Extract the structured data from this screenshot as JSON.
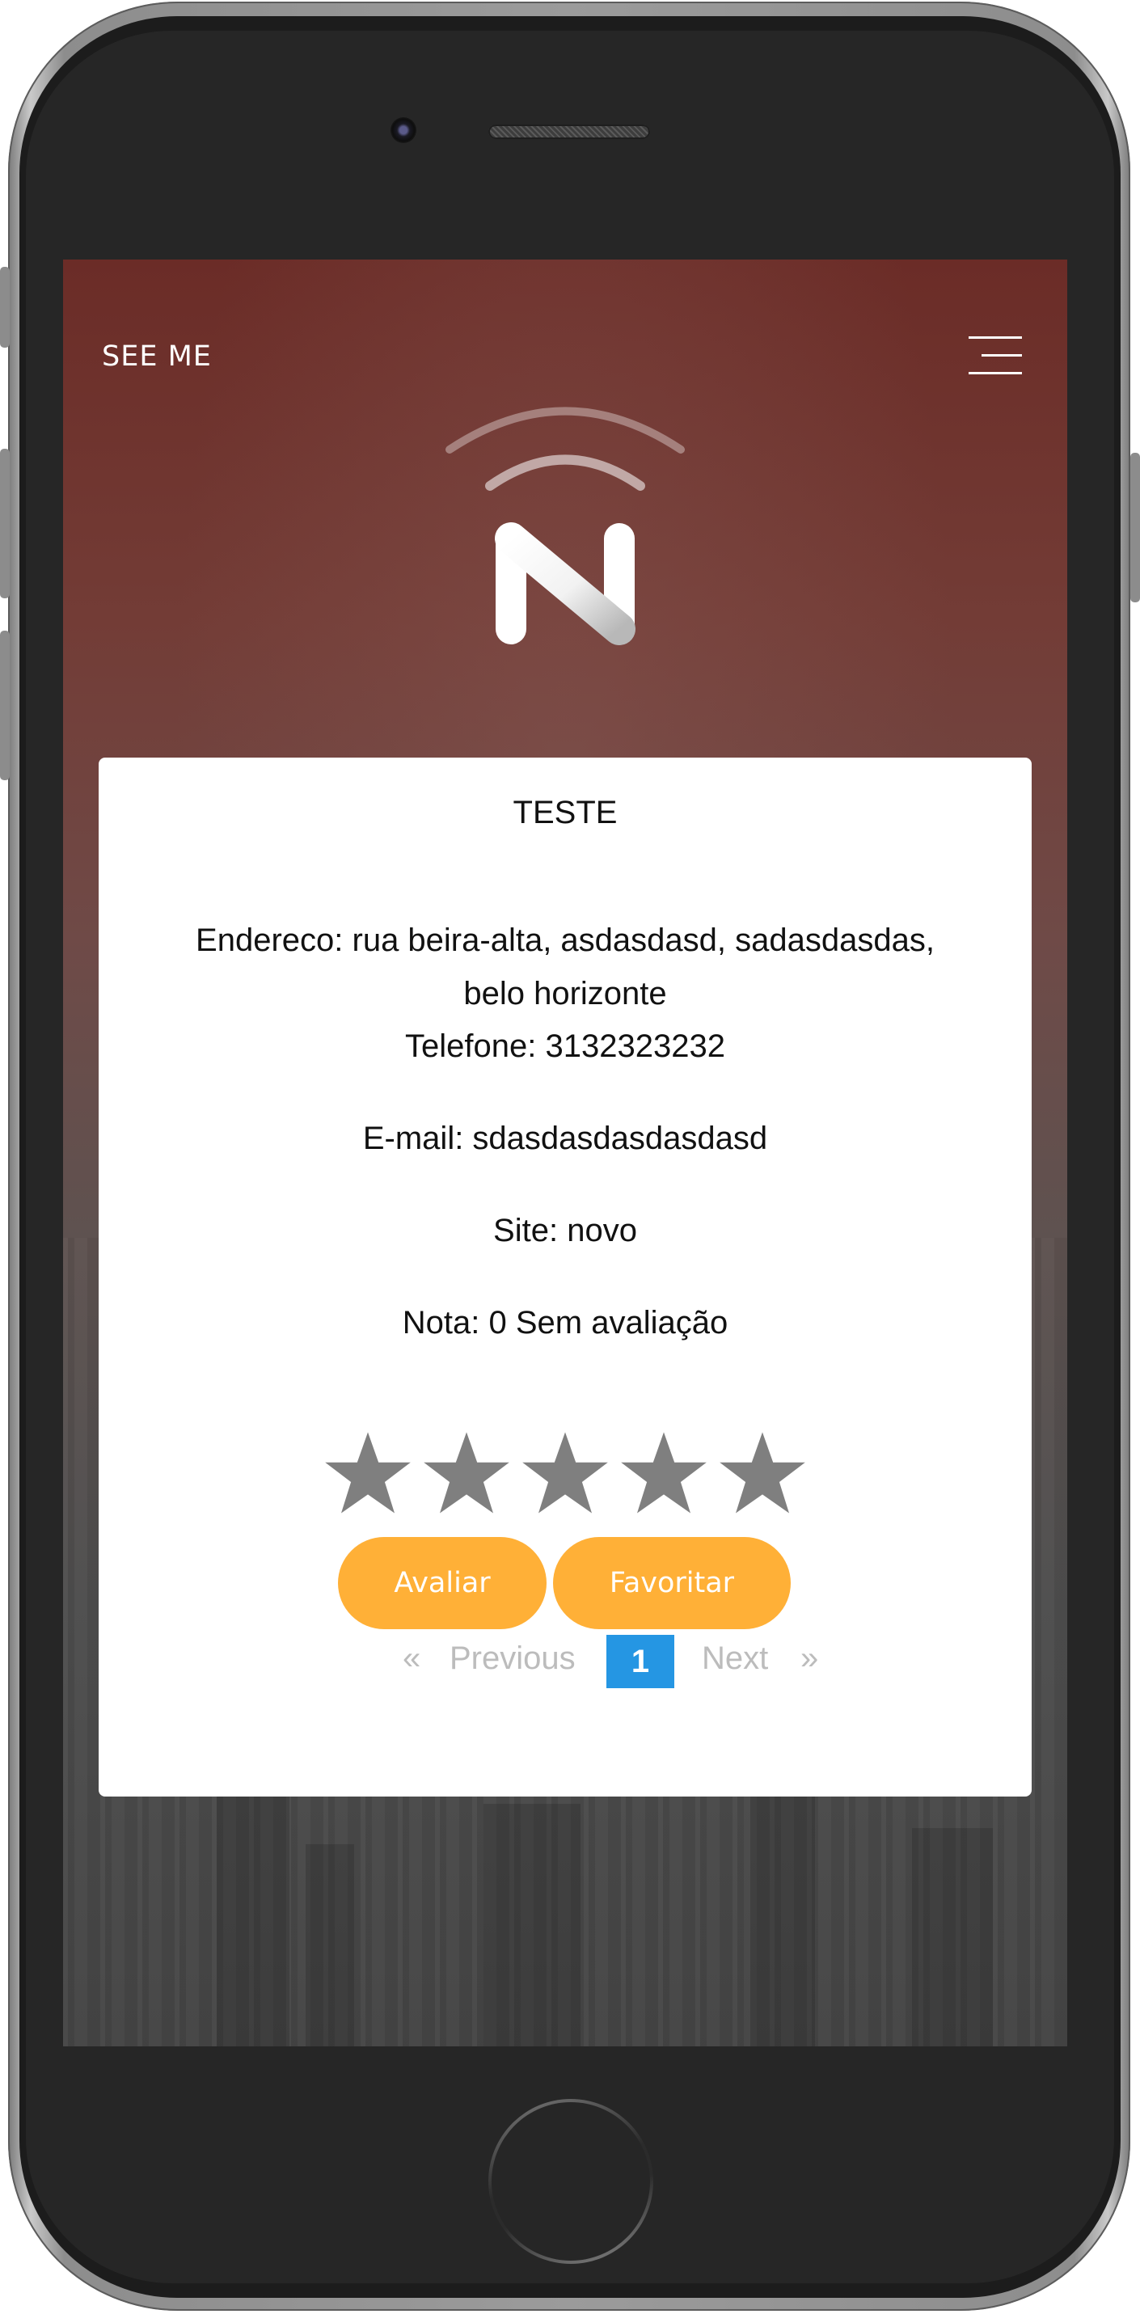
{
  "navbar": {
    "brand": "SEE ME",
    "menu_icon": "hamburger-icon"
  },
  "logo": {
    "icon": "n-signal-logo"
  },
  "card": {
    "title": "TESTE",
    "address": "Endereco: rua beira-alta, asdasdasd, sadasdasdas, belo horizonte",
    "phone": "Telefone: 3132323232",
    "email": "E-mail: sdasdasdasdasdasd",
    "site": "Site: novo",
    "rating": "Nota: 0 Sem avaliação",
    "stars": {
      "count": 5,
      "filled": 0,
      "icon": "star-icon",
      "color": "#7f7f7f"
    },
    "buttons": {
      "rate": "Avaliar",
      "favorite": "Favoritar",
      "color": "#ffb037"
    }
  },
  "pagination": {
    "first": "«",
    "previous": "Previous",
    "current": "1",
    "next": "Next",
    "last": "»",
    "active_color": "#2596e3"
  }
}
